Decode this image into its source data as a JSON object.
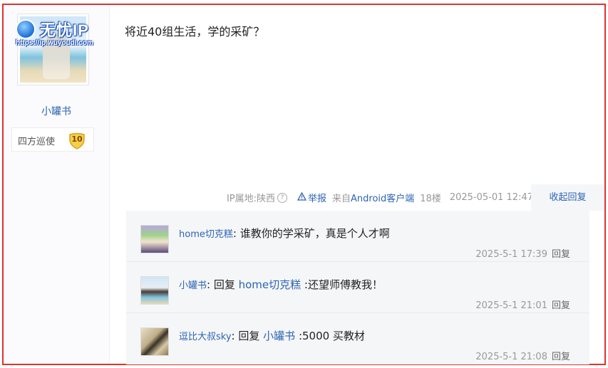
{
  "watermark": {
    "title": "无忧IP",
    "url": "https://ip.wuyoudl.com"
  },
  "author": {
    "name": "小罐书",
    "level_name": "四方巡使",
    "level": "10"
  },
  "post": {
    "text": "将近40组生活，学的采矿？"
  },
  "meta": {
    "ip": "IP属地:陕西",
    "help_icon": "?",
    "report_icon": "warning-icon",
    "report": "举报",
    "client_prefix": "来自",
    "client": "Android客户端",
    "floor": "18楼",
    "time": "2025-05-01 12:47"
  },
  "collapse_label": "收起回复",
  "reply_link_label": "回复",
  "replies": [
    {
      "user": "home切克糕",
      "colon": ":",
      "reply_prefix": "",
      "mention": "",
      "text": " 谁教你的学采矿，真是个人才啊",
      "time": "2025-5-1 17:39"
    },
    {
      "user": "小罐书",
      "colon": ":",
      "reply_prefix": " 回复 ",
      "mention": "home切克糕",
      "text": " :还望师傅教我！",
      "time": "2025-5-1 21:01"
    },
    {
      "user": "逗比大叔sky",
      "colon": ":",
      "reply_prefix": " 回复 ",
      "mention": "小罐书",
      "text": " :5000 买教材",
      "time": "2025-5-1 21:08"
    }
  ],
  "colors": {
    "link": "#2d64b3",
    "frame": "#dd3333",
    "reply_bg": "#f5f6f8"
  }
}
